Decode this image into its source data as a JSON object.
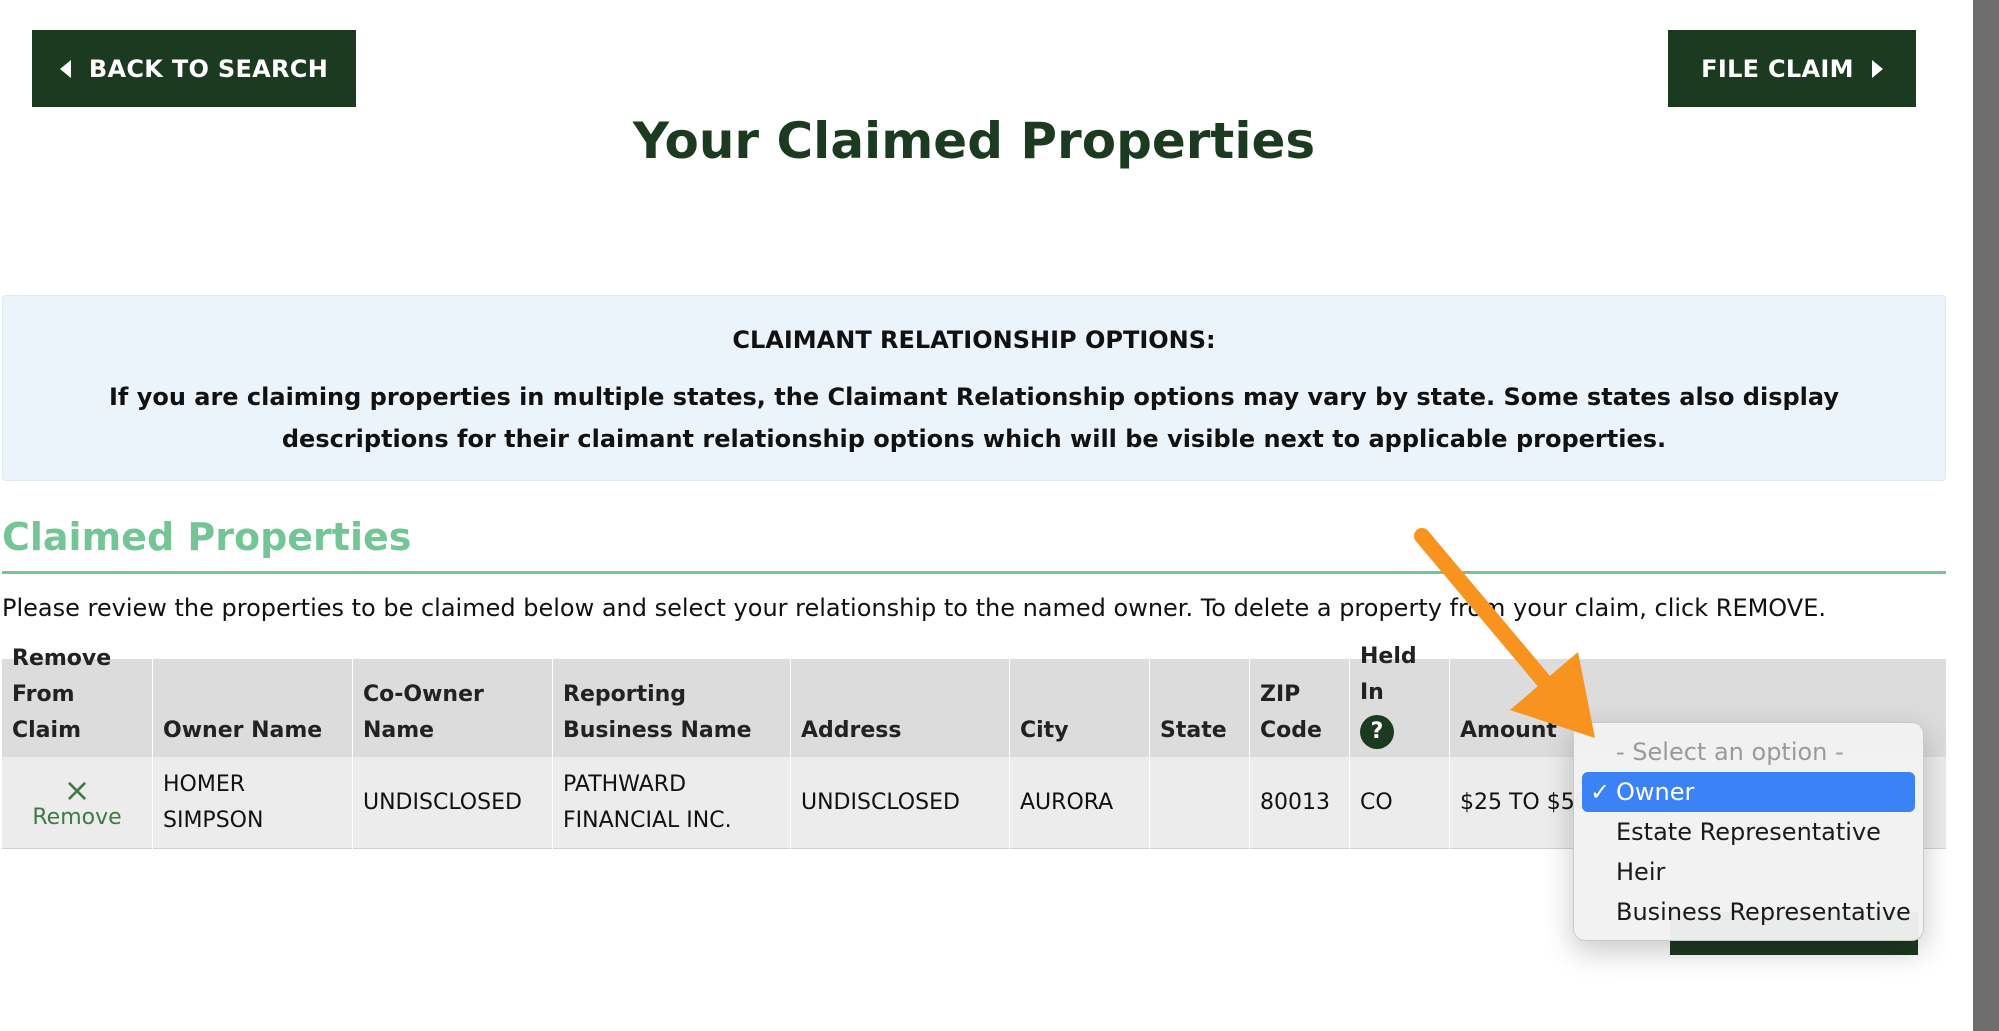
{
  "header": {
    "back_label": "BACK TO SEARCH",
    "file_label": "FILE CLAIM",
    "page_title": "Your Claimed Properties"
  },
  "info_box": {
    "heading": "CLAIMANT RELATIONSHIP OPTIONS:",
    "body": "If you are claiming properties in multiple states, the Claimant Relationship options may vary by state. Some states also display descriptions for their claimant relationship options which will be visible next to applicable properties."
  },
  "section": {
    "title": "Claimed Properties",
    "instructions": "Please review the properties to be claimed below and select your relationship to the named owner. To delete a property from your claim, click REMOVE."
  },
  "table": {
    "headers": {
      "remove": "Remove From Claim",
      "owner": "Owner Name",
      "coowner": "Co-Owner Name",
      "reporting": "Reporting Business Name",
      "address": "Address",
      "city": "City",
      "state": "State",
      "zip": "ZIP Code",
      "held_in": "Held In",
      "held_in_help": "?",
      "amount": "Amount"
    },
    "rows": [
      {
        "remove_icon": "×",
        "remove_label": "Remove",
        "owner": "HOMER SIMPSON",
        "coowner": "UNDISCLOSED",
        "reporting": "PATHWARD FINANCIAL INC.",
        "address": "UNDISCLOSED",
        "city": "AURORA",
        "state": "",
        "zip": "80013",
        "held_in": "CO",
        "amount": "$25 TO $50"
      }
    ]
  },
  "relationship_dropdown": {
    "placeholder": "- Select an option -",
    "selected": "Owner",
    "check": "✓",
    "options": [
      "Owner",
      "Estate Representative",
      "Heir",
      "Business Representative"
    ]
  },
  "colors": {
    "brand_dark_green": "#1c3a20",
    "accent_green": "#74c595",
    "info_bg": "#ebf4fa",
    "arrow_orange": "#f7931e",
    "select_blue": "#3b82f6"
  }
}
